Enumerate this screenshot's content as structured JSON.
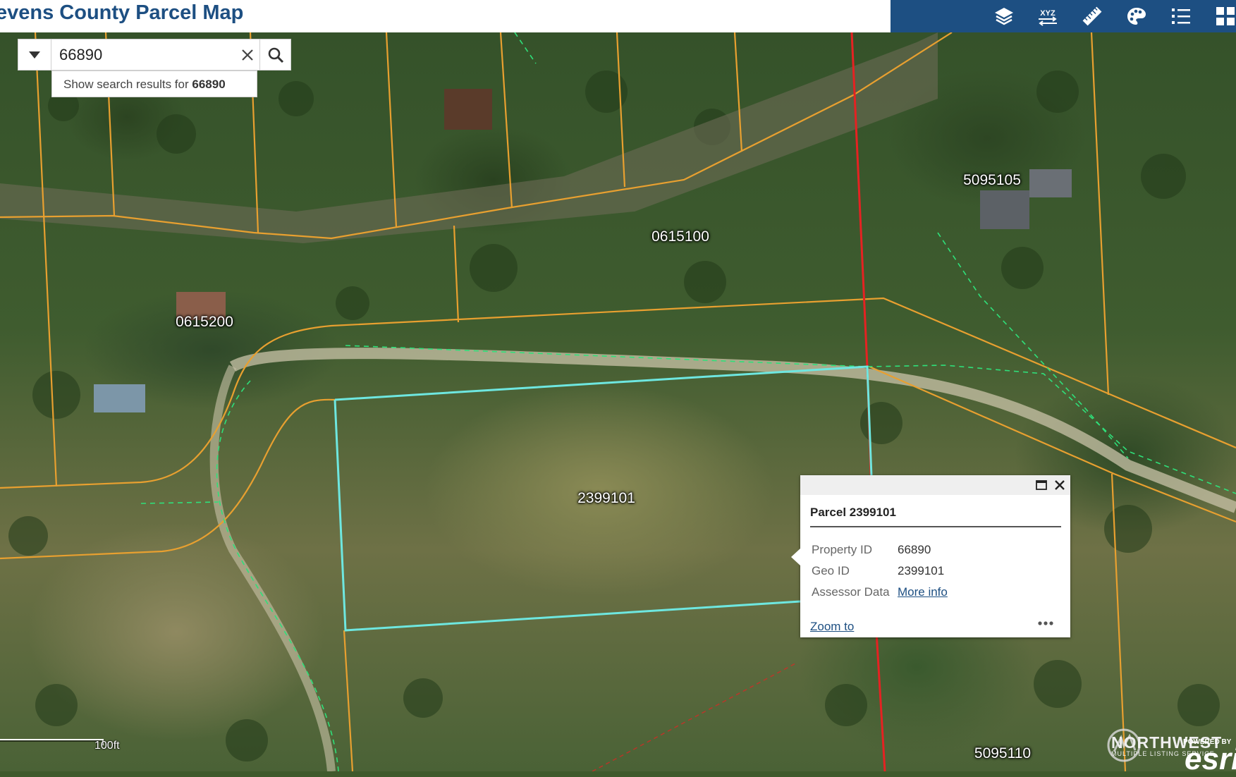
{
  "header": {
    "title": "evens County Parcel Map",
    "toolbar": {
      "icons": [
        "layers-icon",
        "coordinate-conversion-icon",
        "measure-icon",
        "basemap-gallery-icon",
        "legend-icon",
        "apps-icon"
      ],
      "coordinate_label": "XYZ"
    }
  },
  "search": {
    "value": "66890",
    "suggestion_prefix": "Show search results for",
    "suggestion_term": "66890"
  },
  "map": {
    "parcel_labels": [
      "0615100",
      "5095105",
      "0615200",
      "2399101",
      "5095110"
    ],
    "scale_label": "100ft",
    "colors": {
      "parcel_line": "#e8a030",
      "selected_parcel": "#6ee7e0",
      "boundary_line": "#e52222",
      "road_line": "#2fe07a"
    }
  },
  "popup": {
    "title": "Parcel 2399101",
    "rows": [
      {
        "label": "Property ID",
        "value": "66890"
      },
      {
        "label": "Geo ID",
        "value": "2399101"
      },
      {
        "label": "Assessor Data",
        "value": "More info"
      }
    ],
    "zoom_to": "Zoom to"
  },
  "attribution": {
    "nwmls_name": "NORTHWEST",
    "nwmls_sub": "MULTIPLE LISTING SERVICE",
    "esri_powered": "POWERED BY",
    "esri_name": "esri"
  }
}
